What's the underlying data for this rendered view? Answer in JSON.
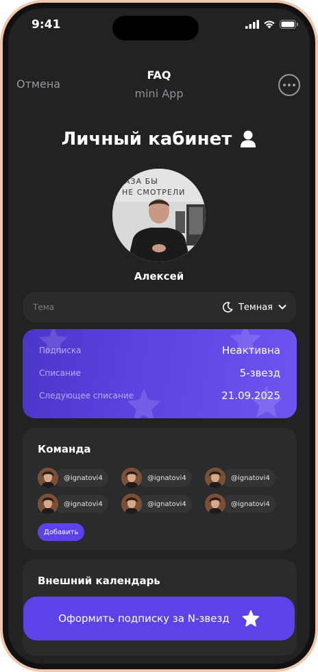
{
  "status_bar": {
    "time": "9:41"
  },
  "header": {
    "cancel": "Отмена",
    "title": "FAQ",
    "subtitle": "mini App"
  },
  "page": {
    "title": "Личный кабинет"
  },
  "profile": {
    "name": "Алексей",
    "photo_text": [
      "АЗА БЫ",
      "НЕ СМОТРЕЛИ"
    ]
  },
  "theme": {
    "label": "Тема",
    "value": "Темная"
  },
  "subscription": {
    "rows": [
      {
        "label": "Подписка",
        "value": "Неактивна"
      },
      {
        "label": "Списание",
        "value": "5-звезд"
      },
      {
        "label": "Следующее списание",
        "value": "21.09.2025"
      }
    ]
  },
  "team": {
    "title": "Команда",
    "members": [
      "@ignatovi4",
      "@ignatovi4",
      "@ignatovi4",
      "@ignatovi4",
      "@ignatovi4",
      "@ignatovi4"
    ],
    "add_label": "Добавить"
  },
  "calendar": {
    "title": "Внешний календарь"
  },
  "main_button": {
    "label": "Оформить подписку за N-звезд"
  },
  "colors": {
    "accent": "#5b43e8",
    "background": "#222224",
    "card": "#2b2b2e",
    "frame": "#f2c8ac"
  },
  "icons": [
    "signal-icon",
    "wifi-icon",
    "battery-icon",
    "more-icon",
    "user-icon",
    "moon-icon",
    "chevron-down-icon",
    "star-icon"
  ]
}
